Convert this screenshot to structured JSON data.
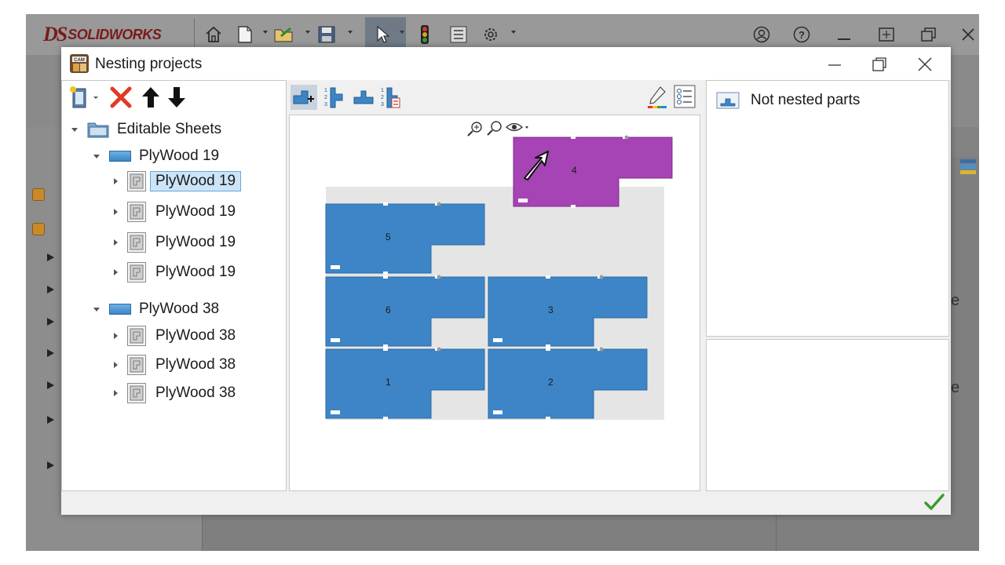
{
  "app": {
    "brand_prefix": "DS",
    "brand_name": "SOLIDWORKS",
    "toolbar_icons": [
      "home-icon",
      "new-document-icon",
      "open-icon",
      "save-icon",
      "select-arrow-icon",
      "traffic-light-icon",
      "properties-icon",
      "gear-icon"
    ],
    "window_controls": [
      "user-icon",
      "help-icon",
      "minimize-icon",
      "maximize-icon",
      "restore-icon",
      "close-icon"
    ],
    "right_letters": [
      "e",
      "e"
    ]
  },
  "dialog": {
    "title": "Nesting projects",
    "controls": {
      "minimize": "—",
      "restore": "❐",
      "close": "✕"
    }
  },
  "tree": {
    "root": {
      "label": "Editable Sheets"
    },
    "groups": [
      {
        "label": "PlyWood 19",
        "children": [
          {
            "label": "PlyWood 19",
            "selected": true
          },
          {
            "label": "PlyWood 19",
            "selected": false
          },
          {
            "label": "PlyWood 19",
            "selected": false
          },
          {
            "label": "PlyWood 19",
            "selected": false
          }
        ]
      },
      {
        "label": "PlyWood 38",
        "children": [
          {
            "label": "PlyWood 38",
            "selected": false
          },
          {
            "label": "PlyWood 38",
            "selected": false
          },
          {
            "label": "PlyWood 38",
            "selected": false
          }
        ]
      }
    ]
  },
  "nesting": {
    "part_color": "#3d85c6",
    "dragged_part_color": "#a643b5",
    "sheet_color": "#e5e5e5",
    "parts": [
      {
        "id": "5",
        "label": "5"
      },
      {
        "id": "6",
        "label": "6"
      },
      {
        "id": "3",
        "label": "3"
      },
      {
        "id": "1",
        "label": "1"
      },
      {
        "id": "2",
        "label": "2"
      },
      {
        "id": "4",
        "label": "4",
        "dragging": true
      }
    ]
  },
  "right_panel": {
    "header": "Not nested parts"
  }
}
